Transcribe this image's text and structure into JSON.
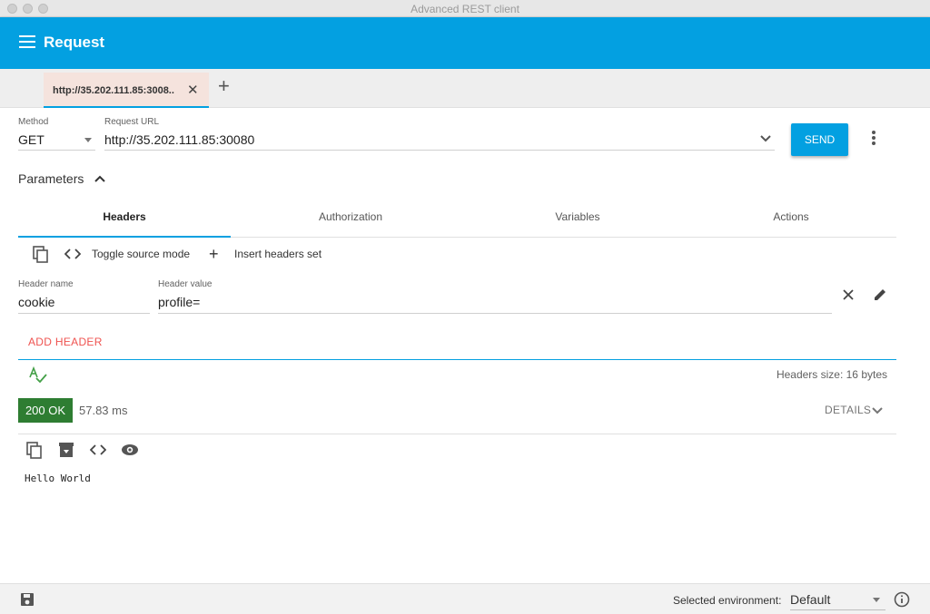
{
  "window": {
    "title": "Advanced REST client"
  },
  "appbar": {
    "title": "Request",
    "menu_icon": "hamburger-menu-icon"
  },
  "tabs": [
    {
      "label": "http://35.202.111.85:3008..",
      "close_icon": "close-icon"
    }
  ],
  "request": {
    "method_label": "Method",
    "method_value": "GET",
    "url_label": "Request URL",
    "url_value": "http://35.202.111.85:30080",
    "send_label": "SEND"
  },
  "parameters": {
    "label": "Parameters",
    "tabs": [
      "Headers",
      "Authorization",
      "Variables",
      "Actions"
    ],
    "active_tab": "Headers"
  },
  "headers_toolbar": {
    "toggle_source_label": "Toggle source mode",
    "insert_set_label": "Insert headers set"
  },
  "header_row": {
    "name_label": "Header name",
    "name_value": "cookie",
    "value_label": "Header value",
    "value_value": "profile="
  },
  "add_header_label": "ADD HEADER",
  "headers_size": "Headers size: 16 bytes",
  "response": {
    "status": "200 OK",
    "status_color": "#2e7d32",
    "timing": "57.83 ms",
    "details_label": "DETAILS",
    "body": "Hello World"
  },
  "footer": {
    "env_label": "Selected environment:",
    "env_value": "Default"
  },
  "colors": {
    "accent": "#03a0e1",
    "add_header": "#ef5350",
    "spellcheck_icon": "#43a047"
  }
}
